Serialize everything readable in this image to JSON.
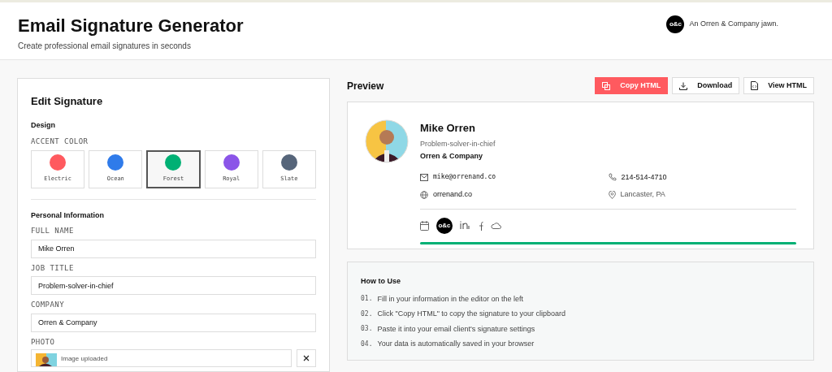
{
  "header": {
    "title": "Email Signature Generator",
    "subtitle": "Create professional email signatures in seconds",
    "brand_logo": "o&c",
    "brand_text": "An Orren & Company jawn."
  },
  "editor": {
    "title": "Edit Signature",
    "design_heading": "Design",
    "accent_label": "ACCENT COLOR",
    "accents": [
      {
        "name": "Electric",
        "color": "#ff5a5f",
        "selected": false
      },
      {
        "name": "Ocean",
        "color": "#2f7bea",
        "selected": false
      },
      {
        "name": "Forest",
        "color": "#00b074",
        "selected": true
      },
      {
        "name": "Royal",
        "color": "#8b55e8",
        "selected": false
      },
      {
        "name": "Slate",
        "color": "#56657a",
        "selected": false
      }
    ],
    "personal_heading": "Personal Information",
    "fields": [
      {
        "label": "FULL NAME",
        "value": "Mike Orren"
      },
      {
        "label": "JOB TITLE",
        "value": "Problem-solver-in-chief"
      },
      {
        "label": "COMPANY",
        "value": "Orren & Company"
      }
    ],
    "photo": {
      "label": "PHOTO",
      "status": "Image uploaded"
    }
  },
  "preview": {
    "title": "Preview",
    "buttons": [
      {
        "label": "Copy HTML",
        "kind": "primary"
      },
      {
        "label": "Download",
        "kind": "download"
      },
      {
        "label": "View HTML",
        "kind": "view"
      }
    ],
    "signature": {
      "name": "Mike Orren",
      "job_title": "Problem-solver-in-chief",
      "company": "Orren & Company",
      "email": "mike@orrenand.co",
      "phone": "214-514-4710",
      "website": "orrenand.co",
      "location": "Lancaster, PA",
      "social_logo": "o&c"
    }
  },
  "how_to": {
    "title": "How to Use",
    "steps": [
      {
        "number": "01.",
        "text": "Fill in your information in the editor on the left"
      },
      {
        "number": "02.",
        "text": "Click \"Copy HTML\" to copy the signature to your clipboard"
      },
      {
        "number": "03.",
        "text": "Paste it into your email client's signature settings"
      },
      {
        "number": "04.",
        "text": "Your data is automatically saved in your browser"
      }
    ]
  }
}
